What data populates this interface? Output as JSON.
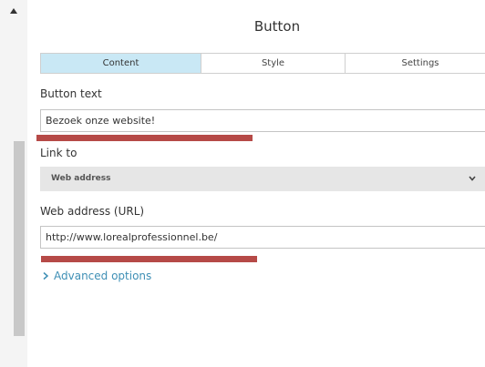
{
  "panel": {
    "title": "Button"
  },
  "tabs": [
    {
      "label": "Content",
      "active": true
    },
    {
      "label": "Style",
      "active": false
    },
    {
      "label": "Settings",
      "active": false
    }
  ],
  "fields": {
    "button_text": {
      "label": "Button text",
      "value": "Bezoek onze website!"
    },
    "link_to": {
      "label": "Link to",
      "selected": "Web address"
    },
    "web_address": {
      "label": "Web address (URL)",
      "value": "http://www.lorealprofessionnel.be/"
    }
  },
  "advanced_options": {
    "label": "Advanced options",
    "icon": "chevron-right-icon"
  },
  "colors": {
    "active_tab": "#c9e8f5",
    "link": "#3e8fb5",
    "annotation_red": "#b64a47"
  }
}
